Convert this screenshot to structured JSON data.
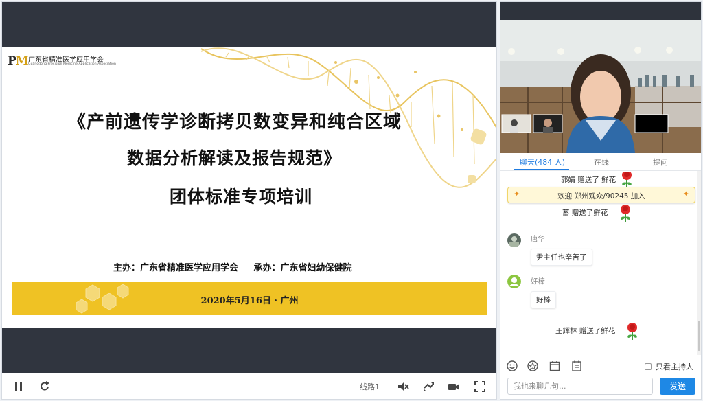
{
  "slide": {
    "logo_mark": "PM",
    "logo_cn": "广东省精准医学应用学会",
    "logo_en": "Guangdong Precision Medicine Application Association",
    "title_line1": "《产前遗传学诊断拷贝数变异和纯合区域",
    "title_line2": "数据分析解读及报告规范》",
    "title_line3": "团体标准专项培训",
    "host": "主办：广东省精准医学应用学会",
    "co_host": "承办：广东省妇幼保健院",
    "date": "2020年5月16日 · 广州"
  },
  "player": {
    "line_label": "线路1",
    "icons": [
      "pause-icon",
      "refresh-icon",
      "mute-icon",
      "rotate-icon",
      "camera-icon",
      "fullscreen-icon"
    ]
  },
  "tabs": [
    {
      "label": "聊天(484 人)",
      "active": true
    },
    {
      "label": "在线",
      "active": false
    },
    {
      "label": "提问",
      "active": false
    }
  ],
  "chat": {
    "gift1": {
      "user": "郭婧",
      "text": "赠送了 鲜花"
    },
    "welcome": "欢迎  郑州观众/90245 加入",
    "gift2": {
      "user": "蓄",
      "text": "赠送了鲜花"
    },
    "msg1": {
      "user": "唐华",
      "text": "尹主任也辛苦了"
    },
    "msg2": {
      "user": "好棒",
      "text": "好棒"
    },
    "gift3": {
      "user": "王辉林",
      "text": "赠送了鲜花"
    }
  },
  "composer": {
    "host_only_label": "只看主持人",
    "placeholder": "我也来聊几句...",
    "send_label": "发送"
  },
  "colors": {
    "accent": "#1e88e5",
    "banner_gold": "#efc224",
    "video_bar": "#30353f"
  }
}
